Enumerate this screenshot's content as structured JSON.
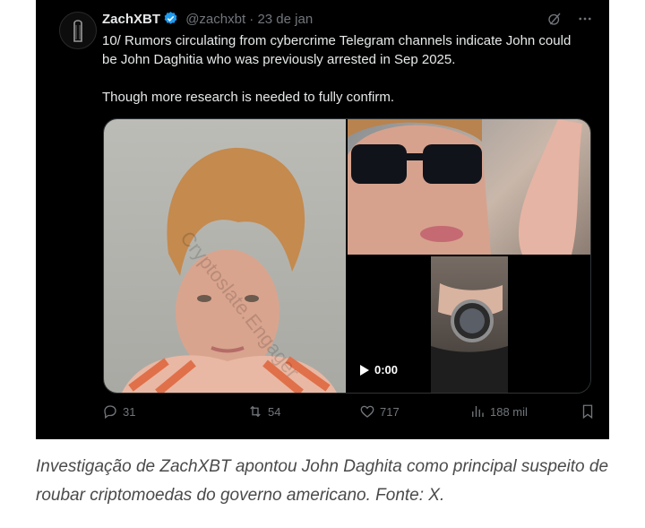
{
  "tweet": {
    "author_name": "ZachXBT",
    "handle": "@zachxbt",
    "separator": "·",
    "date": "23 de jan",
    "paragraphs": [
      "10/ Rumors circulating from cybercrime Telegram channels indicate John could be John Daghitia who was previously arrested in Sep 2025.",
      "Though more research is needed to fully confirm."
    ],
    "media": {
      "video_time": "0:00",
      "watermark": "Cryptoslate.Engager"
    },
    "actions": {
      "replies": "31",
      "reposts": "54",
      "likes": "717",
      "views": "188 mil"
    }
  },
  "caption": "Investigação de ZachXBT apontou John Daghita como principal suspeito de roubar criptomoedas do governo americano. Fonte: X.",
  "colors": {
    "background": "#000000",
    "text": "#e7e9ea",
    "muted": "#71767b",
    "verified": "#1d9bf0"
  }
}
